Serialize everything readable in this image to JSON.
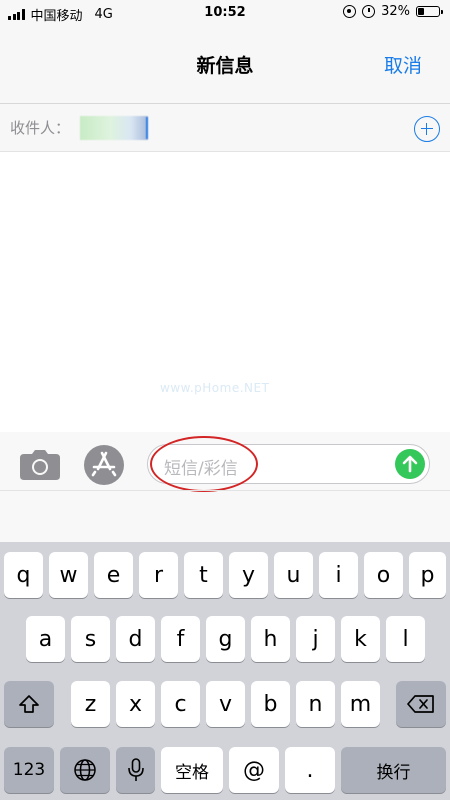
{
  "status_bar": {
    "carrier": "中国移动",
    "network": "4G",
    "time": "10:52",
    "battery_percent": "32%",
    "battery_level": 0.32,
    "icons": [
      "signal-icon",
      "orientation-lock-icon",
      "alarm-icon",
      "battery-icon"
    ]
  },
  "nav": {
    "title": "新信息",
    "cancel_label": "取消"
  },
  "recipient": {
    "label": "收件人：",
    "add_icon": "plus-circle-icon"
  },
  "message_area": {
    "watermark": "www.pHome.NET"
  },
  "compose": {
    "placeholder": "短信/彩信",
    "icons": [
      "camera-icon",
      "app-store-icon",
      "send-arrow-icon"
    ],
    "accent_color": "#34c759",
    "highlight_color": "#d32525"
  },
  "keyboard": {
    "row1": [
      "q",
      "w",
      "e",
      "r",
      "t",
      "y",
      "u",
      "i",
      "o",
      "p"
    ],
    "row2": [
      "a",
      "s",
      "d",
      "f",
      "g",
      "h",
      "j",
      "k",
      "l"
    ],
    "row3": [
      "z",
      "x",
      "c",
      "v",
      "b",
      "n",
      "m"
    ],
    "numbers_label": "123",
    "space_label": "空格",
    "at_label": "@",
    "period_label": ".",
    "return_label": "换行",
    "icons": [
      "shift-icon",
      "delete-icon",
      "globe-icon",
      "microphone-icon"
    ]
  },
  "colors": {
    "link": "#1a7ce8",
    "keyboard_bg": "#d1d3d9"
  }
}
